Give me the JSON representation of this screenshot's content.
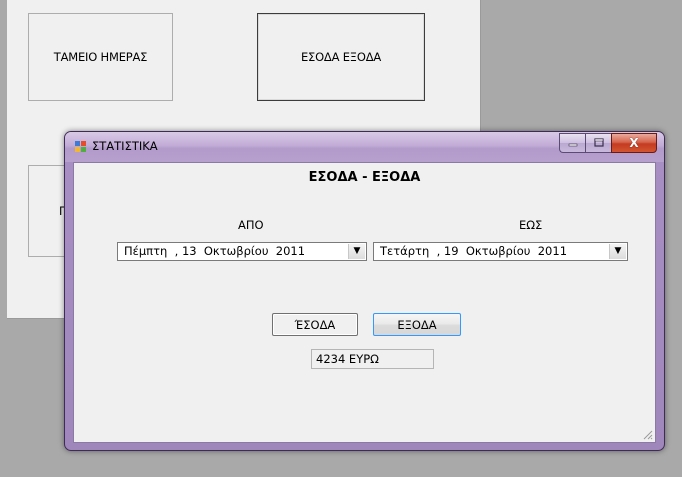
{
  "parent": {
    "button_cashier": "ΤΑΜΕΙΟ ΗΜΕΡΑΣ",
    "button_income_expense": "ΕΣΟΔΑ ΕΞΟΔΑ",
    "button_partial": "Π"
  },
  "dialog": {
    "title": "ΣΤΑΤΙΣΤΙΚΑ",
    "heading": "ΕΣΟΔΑ - ΕΞΟΔΑ",
    "from_label": "ΑΠΟ",
    "to_label": "ΕΩΣ",
    "from_date": "Πέμπτη  , 13  Οκτωβρίου  2011",
    "to_date": "Τετάρτη  , 19  Οκτωβρίου  2011",
    "income_button": "ΈΣΟΔΑ",
    "expense_button": "ΕΞΟΔΑ",
    "result": "4234 ΕΥΡΩ",
    "dropdown_glyph": "▼",
    "close_glyph": "X"
  }
}
